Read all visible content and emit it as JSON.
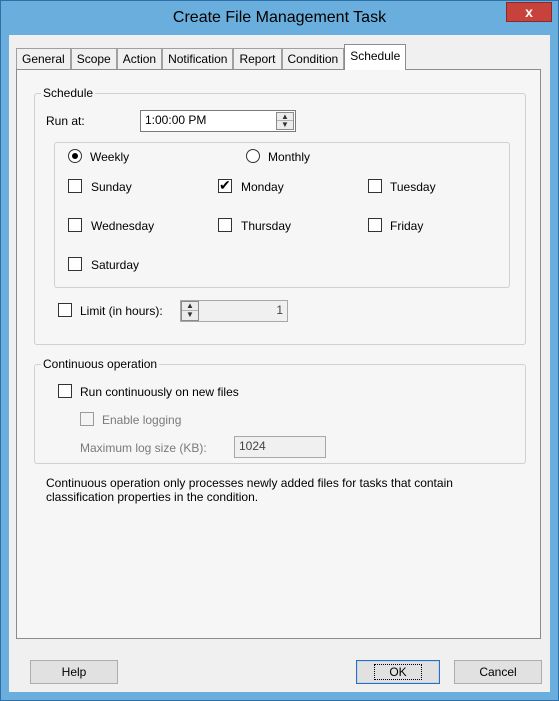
{
  "window": {
    "title": "Create File Management Task",
    "close_glyph": "x"
  },
  "tabs": [
    {
      "label": "General",
      "active": false
    },
    {
      "label": "Scope",
      "active": false
    },
    {
      "label": "Action",
      "active": false
    },
    {
      "label": "Notification",
      "active": false
    },
    {
      "label": "Report",
      "active": false
    },
    {
      "label": "Condition",
      "active": false
    },
    {
      "label": "Schedule",
      "active": true
    }
  ],
  "schedule": {
    "group_label": "Schedule",
    "run_at_label": "Run at:",
    "run_at_value": "1:00:00 PM",
    "frequency": {
      "weekly_label": "Weekly",
      "weekly_selected": true,
      "monthly_label": "Monthly",
      "monthly_selected": false
    },
    "days": [
      {
        "label": "Sunday",
        "checked": false
      },
      {
        "label": "Monday",
        "checked": true
      },
      {
        "label": "Tuesday",
        "checked": false
      },
      {
        "label": "Wednesday",
        "checked": false
      },
      {
        "label": "Thursday",
        "checked": false
      },
      {
        "label": "Friday",
        "checked": false
      },
      {
        "label": "Saturday",
        "checked": false
      }
    ],
    "limit_label": "Limit (in hours):",
    "limit_checked": false,
    "limit_value": "1"
  },
  "continuous": {
    "group_label": "Continuous operation",
    "run_continuously_label": "Run continuously on new files",
    "run_continuously_checked": false,
    "enable_logging_label": "Enable logging",
    "enable_logging_checked": false,
    "max_log_size_label": "Maximum log size (KB):",
    "max_log_size_value": "1024",
    "description": "Continuous operation only processes newly added files for tasks that contain classification properties in the condition."
  },
  "buttons": {
    "help": "Help",
    "ok": "OK",
    "cancel": "Cancel"
  },
  "colors": {
    "titlebar": "#6aaede",
    "close_button": "#c7423a",
    "dialog_bg": "#f0f0f0"
  }
}
